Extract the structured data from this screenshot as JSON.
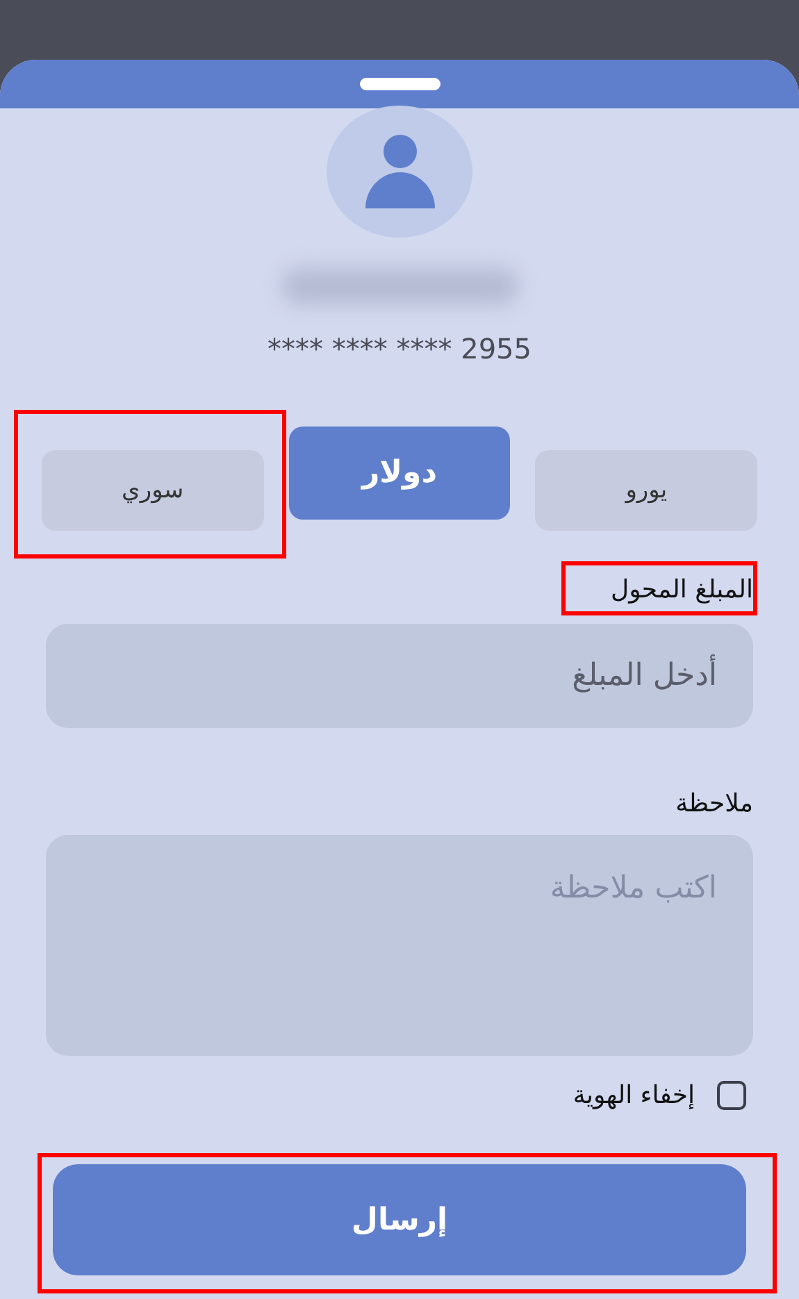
{
  "card_number": "**** **** **** 2955",
  "currencies": [
    {
      "label": "يورو",
      "selected": false,
      "highlighted": false
    },
    {
      "label": "دولار",
      "selected": true,
      "highlighted": false
    },
    {
      "label": "سوري",
      "selected": false,
      "highlighted": true
    }
  ],
  "amount": {
    "label": "المبلغ المحول",
    "placeholder": "أدخل المبلغ",
    "highlighted": true
  },
  "note": {
    "label": "ملاحظة",
    "placeholder": "اكتب ملاحظة"
  },
  "hide_identity": {
    "label": "إخفاء الهوية",
    "checked": false
  },
  "send_button": {
    "label": "إرسال",
    "highlighted": true
  }
}
